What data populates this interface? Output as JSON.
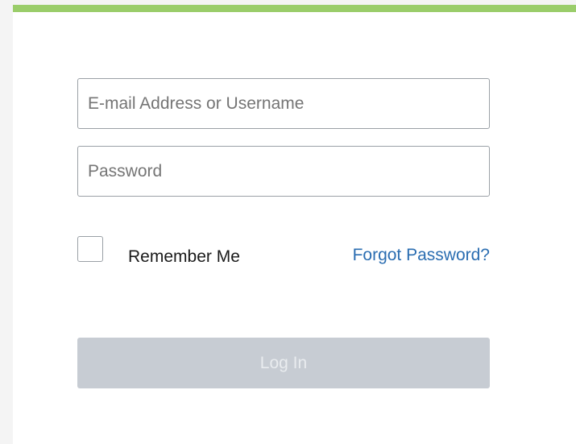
{
  "login_form": {
    "username_placeholder": "E-mail Address or Username",
    "password_placeholder": "Password",
    "remember_label": "Remember Me",
    "remember_checked": false,
    "forgot_label": "Forgot Password?",
    "login_label": "Log In"
  },
  "colors": {
    "accent_bar": "#9acd6a",
    "link": "#2a6db1",
    "button_disabled_bg": "#c7ccd3",
    "button_disabled_text": "#e9ecef"
  }
}
